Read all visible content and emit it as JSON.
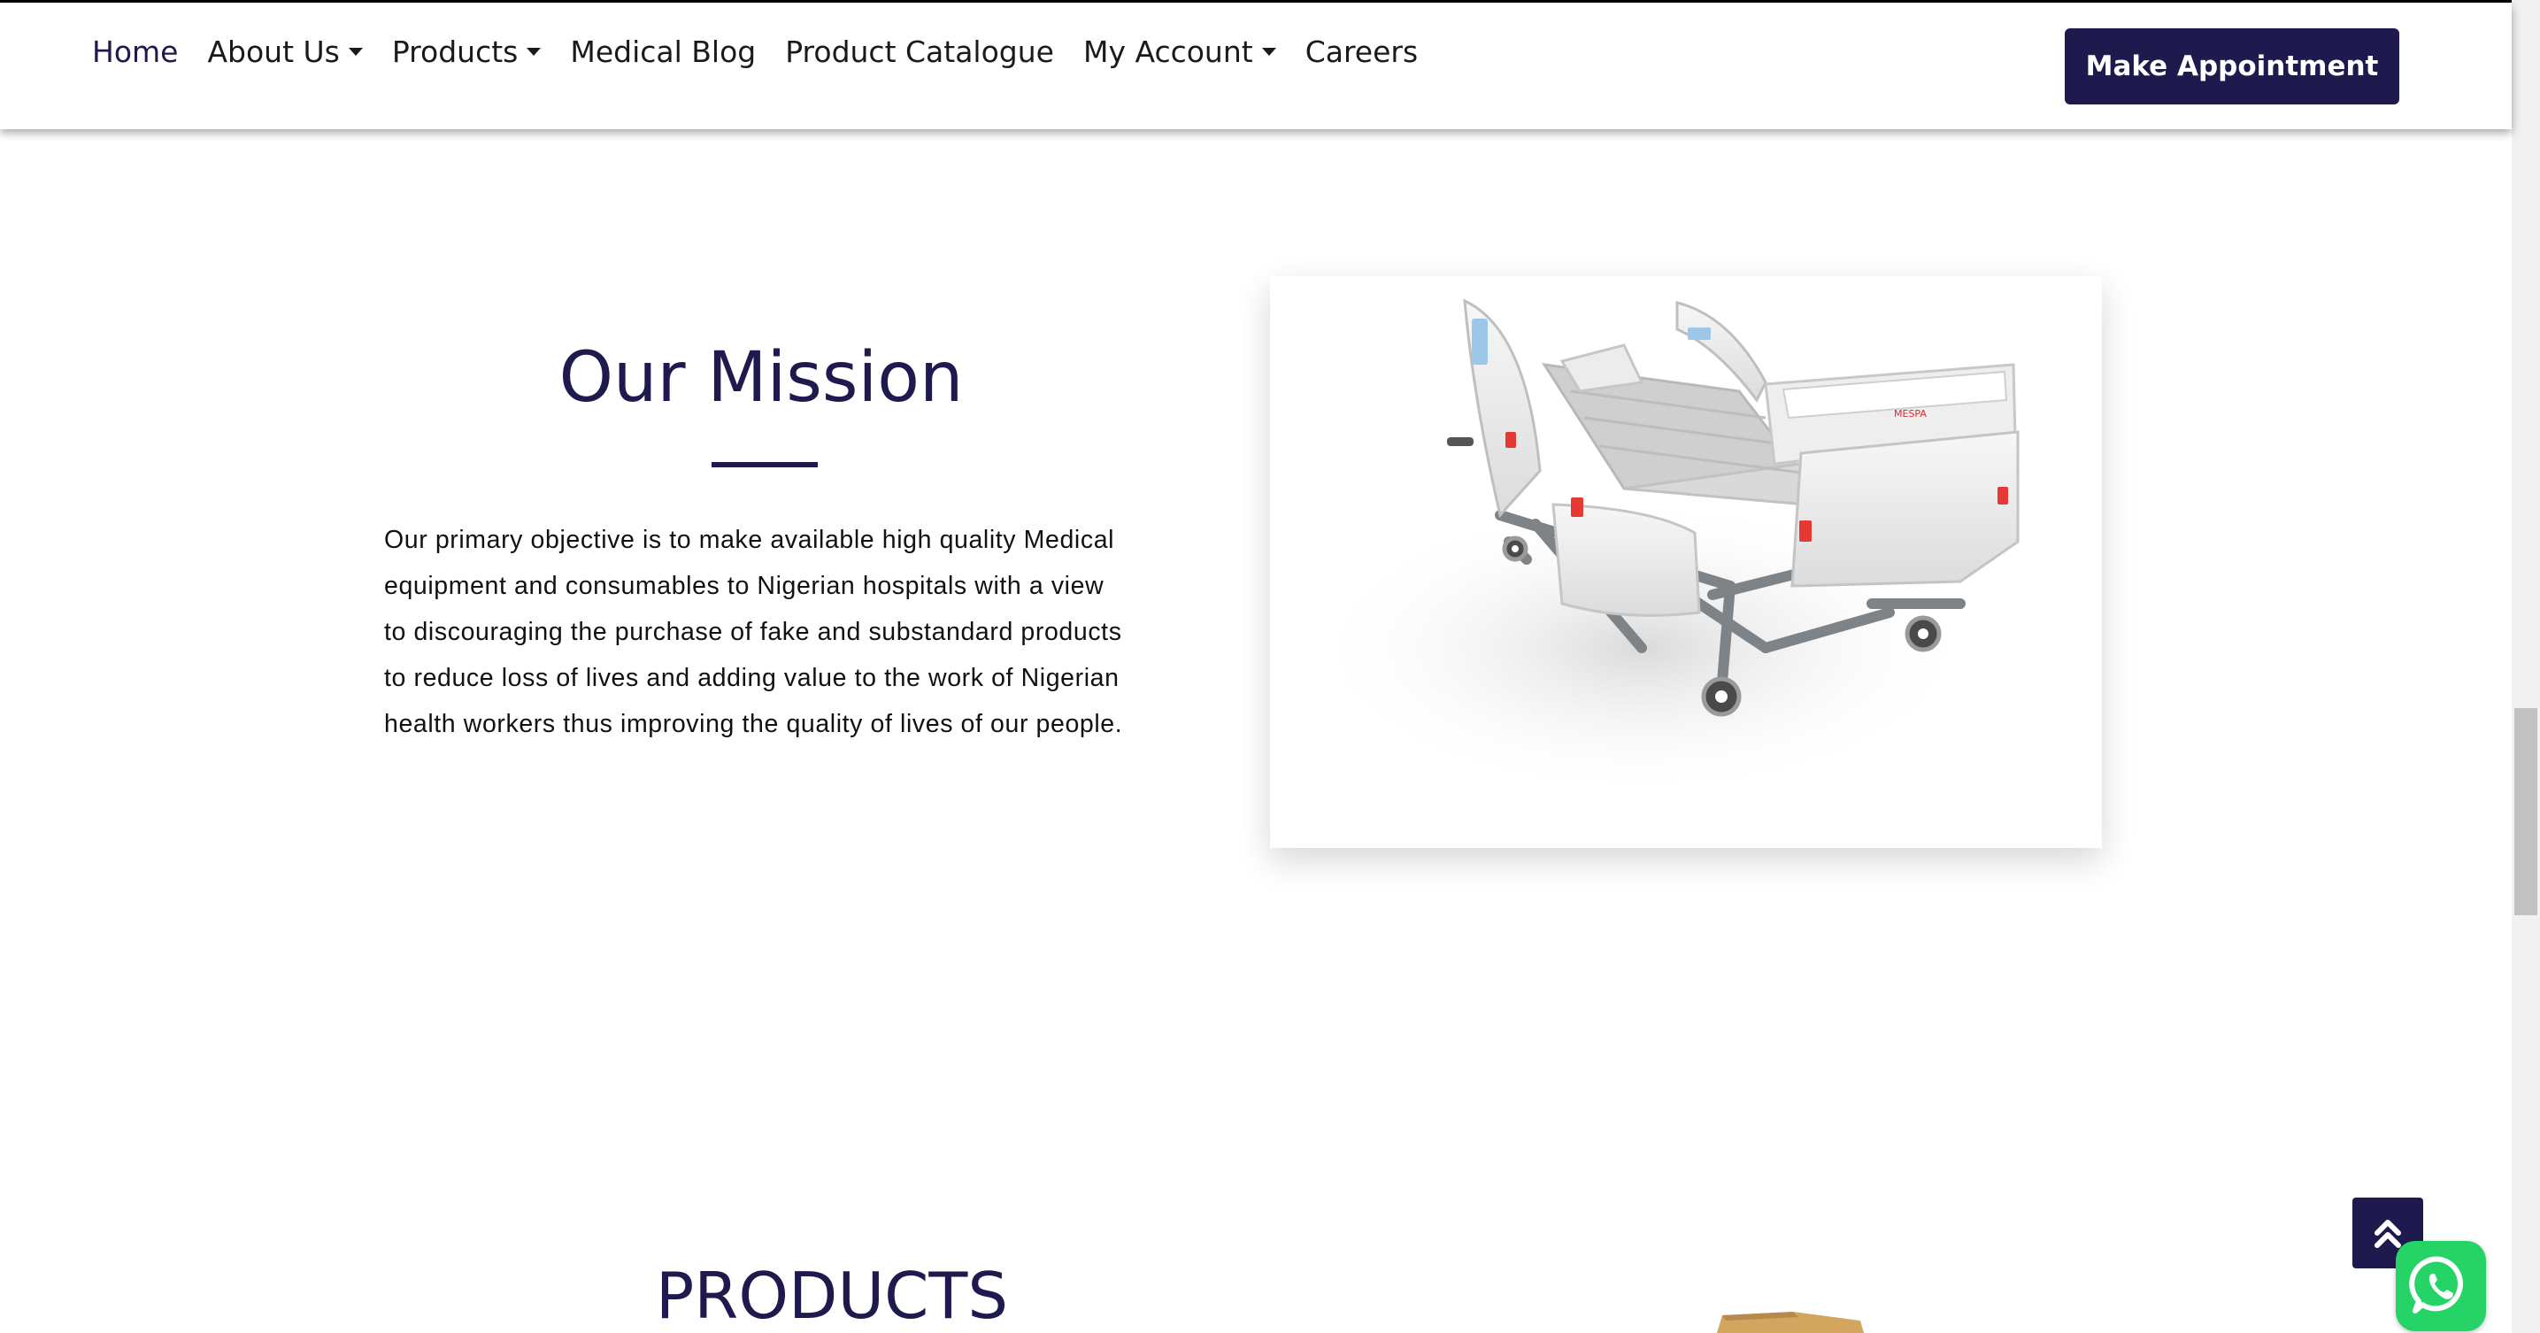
{
  "nav": {
    "items": [
      {
        "label": "Home",
        "dropdown": false,
        "active": true
      },
      {
        "label": "About Us",
        "dropdown": true,
        "active": false
      },
      {
        "label": "Products",
        "dropdown": true,
        "active": false
      },
      {
        "label": "Medical Blog",
        "dropdown": false,
        "active": false
      },
      {
        "label": "Product Catalogue",
        "dropdown": false,
        "active": false
      },
      {
        "label": "My Account",
        "dropdown": true,
        "active": false
      },
      {
        "label": "Careers",
        "dropdown": false,
        "active": false
      }
    ],
    "cta_label": "Make Appointment"
  },
  "mission": {
    "title": "Our Mission",
    "lines": [
      "Our primary objective is to make available high quality Medical",
      "equipment and consumables to Nigerian hospitals with a view",
      "to discouraging the purchase of fake and substandard products",
      "to reduce loss of lives and adding value to the work of Nigerian",
      "health workers thus improving the quality of lives of our people."
    ],
    "image_brand": "MESPA"
  },
  "products": {
    "title": "PRODUCTS"
  },
  "icons": {
    "to_top": "double-chevron-up-icon",
    "whatsapp": "whatsapp-icon"
  },
  "colors": {
    "brand": "#1e1a4e",
    "whatsapp": "#25d366"
  }
}
